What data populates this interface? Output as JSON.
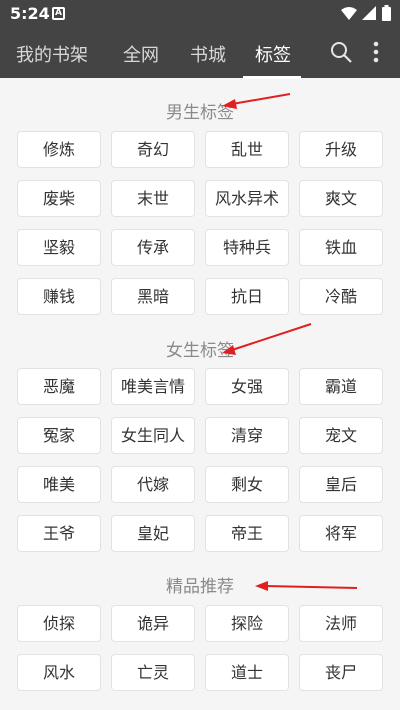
{
  "status_bar": {
    "time": "5:24",
    "notification_icon": "A",
    "icons": [
      "wifi-icon",
      "signal-icon",
      "battery-icon"
    ]
  },
  "header": {
    "tabs": [
      {
        "label": "我的书架",
        "active": false
      },
      {
        "label": "全网",
        "active": false
      },
      {
        "label": "书城",
        "active": false
      },
      {
        "label": "标签",
        "active": true
      }
    ],
    "icons": [
      "search-icon",
      "more-vert-icon"
    ],
    "background_color": "#444444"
  },
  "sections": [
    {
      "title": "男生标签",
      "rows": [
        [
          "修炼",
          "奇幻",
          "乱世",
          "升级"
        ],
        [
          "废柴",
          "末世",
          "风水异术",
          "爽文"
        ],
        [
          "坚毅",
          "传承",
          "特种兵",
          "铁血"
        ],
        [
          "赚钱",
          "黑暗",
          "抗日",
          "冷酷"
        ]
      ]
    },
    {
      "title": "女生标签",
      "rows": [
        [
          "恶魔",
          "唯美言情",
          "女强",
          "霸道"
        ],
        [
          "冤家",
          "女生同人",
          "清穿",
          "宠文"
        ],
        [
          "唯美",
          "代嫁",
          "剩女",
          "皇后"
        ],
        [
          "王爷",
          "皇妃",
          "帝王",
          "将军"
        ]
      ]
    },
    {
      "title": "精品推荐",
      "rows": [
        [
          "侦探",
          "诡异",
          "探险",
          "法师"
        ],
        [
          "风水",
          "亡灵",
          "道士",
          "丧尸"
        ]
      ]
    }
  ],
  "annotation_color": "#e02020"
}
